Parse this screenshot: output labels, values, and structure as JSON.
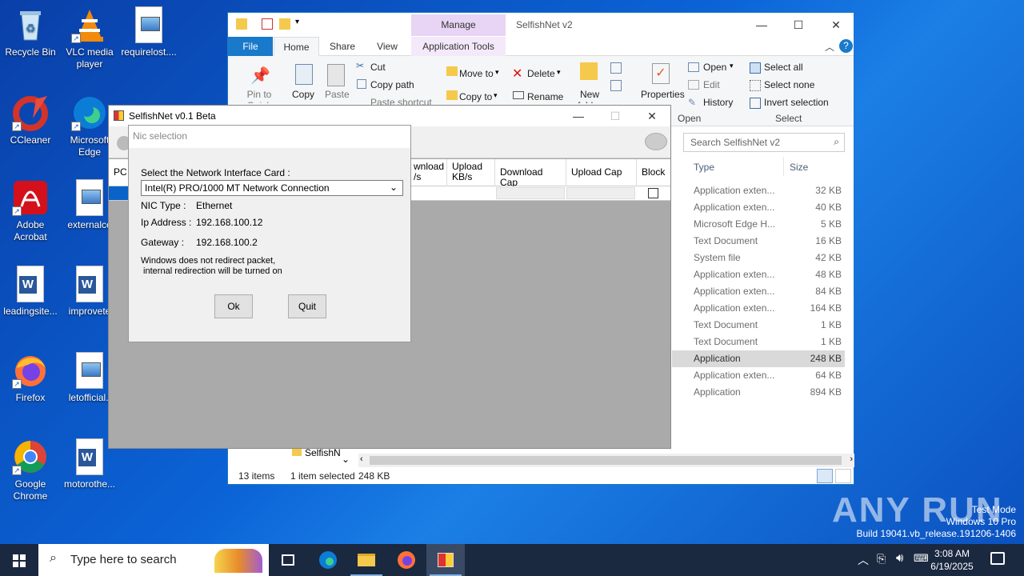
{
  "desktop": {
    "icons": [
      {
        "label": "Recycle Bin"
      },
      {
        "label": "VLC media player"
      },
      {
        "label": "requirelost...."
      },
      {
        "label": "CCleaner"
      },
      {
        "label": "Microsoft Edge"
      },
      {
        "label": "Adobe Acrobat"
      },
      {
        "label": "externalce"
      },
      {
        "label": "leadingsite..."
      },
      {
        "label": "improvete"
      },
      {
        "label": "Firefox"
      },
      {
        "label": "letofficial.j"
      },
      {
        "label": "Google Chrome"
      },
      {
        "label": "motorothe..."
      }
    ]
  },
  "explorer": {
    "title": "SelfishNet v2",
    "manage_tab": "Manage",
    "tabs": {
      "file": "File",
      "home": "Home",
      "share": "Share",
      "view": "View",
      "app_tools": "Application Tools"
    },
    "ribbon": {
      "pin": "Pin to Quick access",
      "copy": "Copy",
      "paste": "Paste",
      "cut": "Cut",
      "copy_path": "Copy path",
      "paste_shortcut": "Paste shortcut",
      "move_to": "Move to",
      "copy_to": "Copy to",
      "delete": "Delete",
      "rename": "Rename",
      "new_folder": "New folder",
      "properties": "Properties",
      "open": "Open",
      "edit": "Edit",
      "history": "History",
      "open_group": "Open",
      "select_all": "Select all",
      "select_none": "Select none",
      "invert_selection": "Invert selection",
      "select_group": "Select"
    },
    "search_placeholder": "Search SelfishNet v2",
    "columns": {
      "type": "Type",
      "size": "Size"
    },
    "files": [
      {
        "type": "Application exten...",
        "size": "32 KB"
      },
      {
        "type": "Application exten...",
        "size": "40 KB"
      },
      {
        "type": "Microsoft Edge H...",
        "size": "5 KB"
      },
      {
        "type": "Text Document",
        "size": "16 KB"
      },
      {
        "type": "System file",
        "size": "42 KB"
      },
      {
        "type": "Application exten...",
        "size": "48 KB"
      },
      {
        "type": "Application exten...",
        "size": "84 KB"
      },
      {
        "type": "Application exten...",
        "size": "164 KB"
      },
      {
        "type": "Text Document",
        "size": "1 KB"
      },
      {
        "type": "Text Document",
        "size": "1 KB"
      },
      {
        "type": "Application",
        "size": "248 KB"
      },
      {
        "type": "Application exten...",
        "size": "64 KB"
      },
      {
        "type": "Application",
        "size": "894 KB"
      }
    ],
    "nav_item": "SelfishN",
    "status": {
      "items": "13 items",
      "selected": "1 item selected",
      "size": "248 KB"
    }
  },
  "selfishnet": {
    "title": "SelfishNet v0.1 Beta",
    "columns": {
      "pc": "PC",
      "download": "wnload\n/s",
      "upload": "Upload\nKB/s",
      "download_cap": "Download Cap",
      "upload_cap": "Upload Cap",
      "block": "Block"
    }
  },
  "nic_dialog": {
    "title": "Nic selection",
    "select_label": "Select the Network Interface Card :",
    "selected_nic": "Intel(R) PRO/1000 MT Network Connection",
    "nic_type_label": "NIC Type :",
    "nic_type_value": "Ethernet",
    "ip_label": "Ip Address :",
    "ip_value": "192.168.100.12",
    "gateway_label": "Gateway :",
    "gateway_value": "192.168.100.2",
    "note_line1": "Windows does not redirect packet,",
    "note_line2": " internal redirection will be turned on",
    "ok": "Ok",
    "quit": "Quit"
  },
  "taskbar": {
    "search_placeholder": "Type here to search",
    "time": "3:08 AM",
    "date": "6/19/2025"
  },
  "watermark": {
    "brand": "ANY RUN",
    "line1": "Test Mode",
    "line2": "Windows 10 Pro",
    "line3": "Build 19041.vb_release.191206-1406"
  },
  "colors": {
    "accent": "#1979ca",
    "taskbar": "#1a2840",
    "manage_tab": "#e8d5f5"
  }
}
